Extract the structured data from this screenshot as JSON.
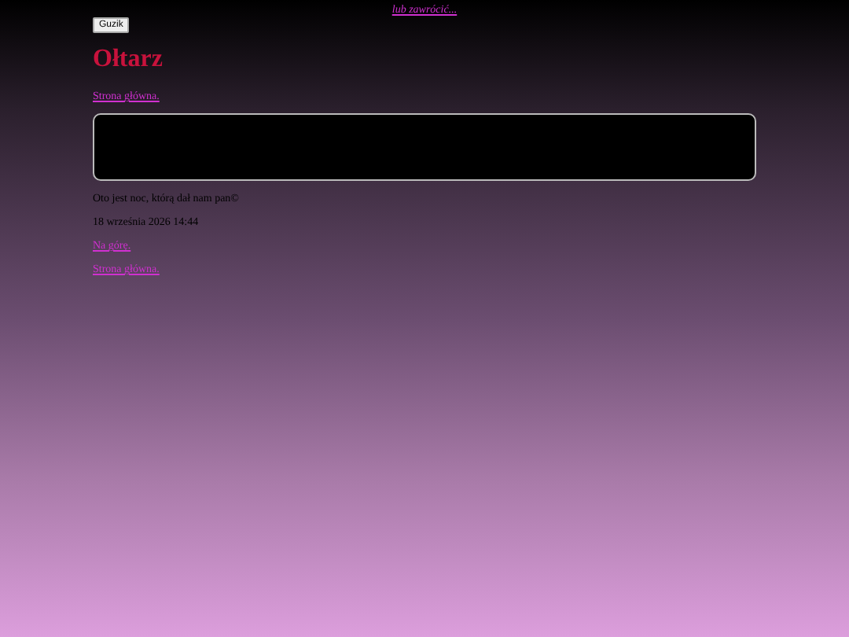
{
  "top_link": "lub zawrócić...",
  "button": "Guzik",
  "title": "Ołtarz",
  "home_link": "Strona główna.",
  "caption": "Oto jest noc, którą dał nam pan©",
  "date": "18 września 2026 14:44",
  "footer_links": [
    "Na górę.",
    "Strona główna."
  ]
}
